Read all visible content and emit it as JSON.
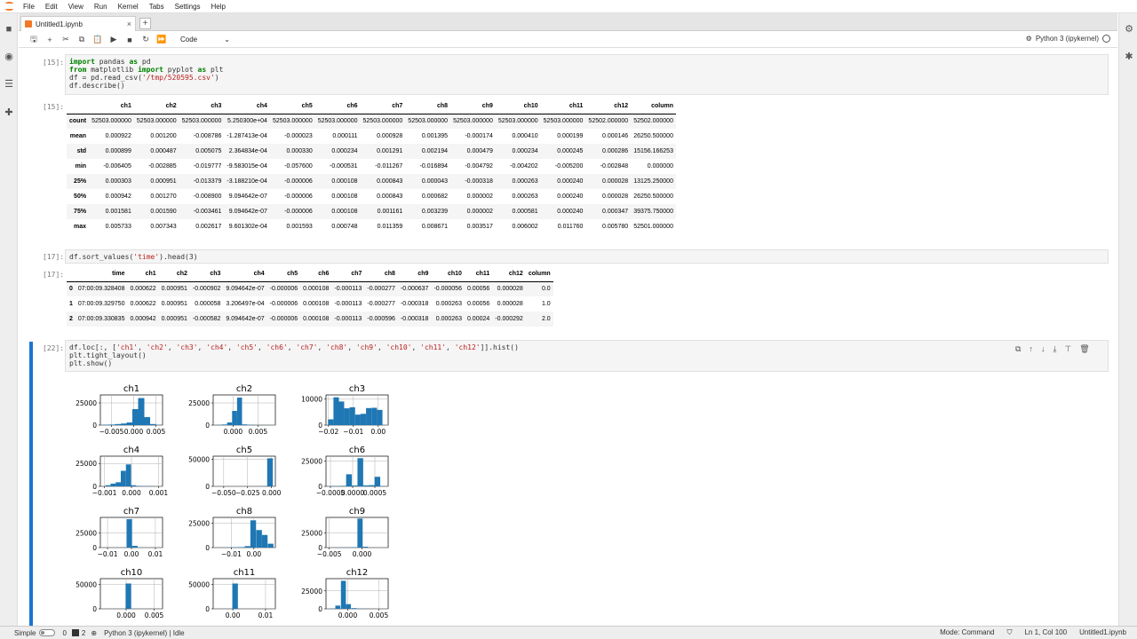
{
  "menubar": {
    "items": [
      "File",
      "Edit",
      "View",
      "Run",
      "Kernel",
      "Tabs",
      "Settings",
      "Help"
    ]
  },
  "tab": {
    "title": "Untitled1.ipynb",
    "close": "×",
    "new": "+"
  },
  "toolbar": {
    "cell_type": "Code",
    "kernel": "Python 3 (ipykernel)"
  },
  "cells": {
    "c1": {
      "prompt": "[15]:",
      "out_prompt": "[15]:",
      "lines": [
        [
          {
            "t": "import",
            "c": "kw"
          },
          {
            "t": " pandas "
          },
          {
            "t": "as",
            "c": "kw"
          },
          {
            "t": " pd"
          }
        ],
        [
          {
            "t": "from",
            "c": "kw"
          },
          {
            "t": " matplotlib "
          },
          {
            "t": "import",
            "c": "kw"
          },
          {
            "t": " pyplot "
          },
          {
            "t": "as",
            "c": "kw"
          },
          {
            "t": " plt"
          }
        ],
        [
          {
            "t": "df = pd.read_csv("
          },
          {
            "t": "'/tmp/520595.csv'",
            "c": "str"
          },
          {
            "t": ")"
          }
        ],
        [
          {
            "t": "df.describe()"
          }
        ]
      ]
    },
    "c2": {
      "prompt": "[17]:",
      "out_prompt": "[17]:",
      "lines": [
        [
          {
            "t": "df.sort_values("
          },
          {
            "t": "'time'",
            "c": "str"
          },
          {
            "t": ").head(3)"
          }
        ]
      ]
    },
    "c3": {
      "prompt": "[22]:",
      "lines": [
        [
          {
            "t": "df.loc[:, ["
          },
          {
            "t": "'ch1'",
            "c": "str"
          },
          {
            "t": ", "
          },
          {
            "t": "'ch2'",
            "c": "str"
          },
          {
            "t": ", "
          },
          {
            "t": "'ch3'",
            "c": "str"
          },
          {
            "t": ", "
          },
          {
            "t": "'ch4'",
            "c": "str"
          },
          {
            "t": ", "
          },
          {
            "t": "'ch5'",
            "c": "str"
          },
          {
            "t": ", "
          },
          {
            "t": "'ch6'",
            "c": "str"
          },
          {
            "t": ", "
          },
          {
            "t": "'ch7'",
            "c": "str"
          },
          {
            "t": ", "
          },
          {
            "t": "'ch8'",
            "c": "str"
          },
          {
            "t": ", "
          },
          {
            "t": "'ch9'",
            "c": "str"
          },
          {
            "t": ", "
          },
          {
            "t": "'ch10'",
            "c": "str"
          },
          {
            "t": ", "
          },
          {
            "t": "'ch11'",
            "c": "str"
          },
          {
            "t": ", "
          },
          {
            "t": "'ch12'",
            "c": "str"
          },
          {
            "t": "]].hist()"
          }
        ],
        [
          {
            "t": "plt.tight_layout()"
          }
        ],
        [
          {
            "t": "plt.show()"
          }
        ]
      ]
    }
  },
  "describe": {
    "columns": [
      "",
      "ch1",
      "ch2",
      "ch3",
      "ch4",
      "ch5",
      "ch6",
      "ch7",
      "ch8",
      "ch9",
      "ch10",
      "ch11",
      "ch12",
      "column"
    ],
    "rows": [
      [
        "count",
        "52503.000000",
        "52503.000000",
        "52503.000000",
        "5.250300e+04",
        "52503.000000",
        "52503.000000",
        "52503.000000",
        "52503.000000",
        "52503.000000",
        "52503.000000",
        "52503.000000",
        "52502.000000",
        "52502.000000"
      ],
      [
        "mean",
        "0.000922",
        "0.001200",
        "-0.008786",
        "-1.287413e-04",
        "-0.000023",
        "0.000111",
        "0.000928",
        "0.001395",
        "-0.000174",
        "0.000410",
        "0.000199",
        "0.000146",
        "26250.500000"
      ],
      [
        "std",
        "0.000899",
        "0.000487",
        "0.005075",
        "2.364834e-04",
        "0.000330",
        "0.000234",
        "0.001291",
        "0.002194",
        "0.000479",
        "0.000234",
        "0.000245",
        "0.000286",
        "15156.166253"
      ],
      [
        "min",
        "-0.006405",
        "-0.002885",
        "-0.019777",
        "-9.583015e-04",
        "-0.057600",
        "-0.000531",
        "-0.011267",
        "-0.016894",
        "-0.004792",
        "-0.004202",
        "-0.005200",
        "-0.002848",
        "0.000000"
      ],
      [
        "25%",
        "0.000303",
        "0.000951",
        "-0.013379",
        "-3.188210e-04",
        "-0.000006",
        "0.000108",
        "0.000843",
        "0.000043",
        "-0.000318",
        "0.000263",
        "0.000240",
        "0.000028",
        "13125.250000"
      ],
      [
        "50%",
        "0.000942",
        "0.001270",
        "-0.008900",
        "9.094642e-07",
        "-0.000006",
        "0.000108",
        "0.000843",
        "0.000682",
        "0.000002",
        "0.000263",
        "0.000240",
        "0.000028",
        "26250.500000"
      ],
      [
        "75%",
        "0.001581",
        "0.001590",
        "-0.003461",
        "9.094642e-07",
        "-0.000006",
        "0.000108",
        "0.001161",
        "0.003239",
        "0.000002",
        "0.000581",
        "0.000240",
        "0.000347",
        "39375.750000"
      ],
      [
        "max",
        "0.005733",
        "0.007343",
        "0.002617",
        "9.601302e-04",
        "0.001593",
        "0.000748",
        "0.011359",
        "0.008671",
        "0.003517",
        "0.006002",
        "0.011760",
        "0.005780",
        "52501.000000"
      ]
    ]
  },
  "head": {
    "columns": [
      "",
      "time",
      "ch1",
      "ch2",
      "ch3",
      "ch4",
      "ch5",
      "ch6",
      "ch7",
      "ch8",
      "ch9",
      "ch10",
      "ch11",
      "ch12",
      "column"
    ],
    "rows": [
      [
        "0",
        "07:00:09.328408",
        "0.000622",
        "0.000951",
        "-0.000902",
        "9.094642e-07",
        "-0.000006",
        "0.000108",
        "-0.000113",
        "-0.000277",
        "-0.000637",
        "-0.000056",
        "0.00056",
        "0.000028",
        "0.0"
      ],
      [
        "1",
        "07:00:09.329750",
        "0.000622",
        "0.000951",
        "0.000058",
        "3.206497e-04",
        "-0.000006",
        "0.000108",
        "-0.000113",
        "-0.000277",
        "-0.000318",
        "0.000263",
        "0.00056",
        "0.000028",
        "1.0"
      ],
      [
        "2",
        "07:00:09.330835",
        "0.000942",
        "0.000951",
        "-0.000582",
        "9.094642e-07",
        "-0.000006",
        "0.000108",
        "-0.000113",
        "-0.000596",
        "-0.000318",
        "0.000263",
        "0.00024",
        "-0.000292",
        "2.0"
      ]
    ]
  },
  "chart_data": [
    {
      "type": "bar",
      "title": "ch1",
      "xticks": [
        "−0.005",
        "0.000",
        "0.005"
      ],
      "yticks": [
        "0",
        "25000"
      ],
      "xlim": [
        -0.0075,
        0.0065
      ],
      "ylim": [
        0,
        34000
      ],
      "bins": [
        [
          -0.0062,
          500
        ],
        [
          -0.0048,
          600
        ],
        [
          -0.0035,
          1200
        ],
        [
          -0.0022,
          1800
        ],
        [
          -0.0009,
          3000
        ],
        [
          0.0004,
          18000
        ],
        [
          0.0017,
          30500
        ],
        [
          0.003,
          9000
        ],
        [
          0.0043,
          1200
        ],
        [
          0.0056,
          300
        ]
      ]
    },
    {
      "type": "bar",
      "title": "ch2",
      "xticks": [
        "0.000",
        "0.005"
      ],
      "yticks": [
        "0",
        "25000"
      ],
      "xlim": [
        -0.004,
        0.0085
      ],
      "ylim": [
        0,
        34000
      ],
      "bins": [
        [
          -0.0027,
          300
        ],
        [
          -0.0017,
          700
        ],
        [
          -0.0007,
          3000
        ],
        [
          0.0003,
          16000
        ],
        [
          0.0013,
          31000
        ],
        [
          0.0023,
          800
        ],
        [
          0.0033,
          400
        ],
        [
          0.0043,
          200
        ],
        [
          0.0053,
          100
        ],
        [
          0.0063,
          100
        ]
      ]
    },
    {
      "type": "bar",
      "title": "ch3",
      "xticks": [
        "−0.02",
        "−0.01",
        "0.00"
      ],
      "yticks": [
        "0",
        "10000"
      ],
      "xlim": [
        -0.021,
        0.004
      ],
      "ylim": [
        0,
        11500
      ],
      "bins": [
        [
          -0.0191,
          2200
        ],
        [
          -0.0169,
          10600
        ],
        [
          -0.0148,
          9000
        ],
        [
          -0.0126,
          6400
        ],
        [
          -0.0104,
          6800
        ],
        [
          -0.0082,
          4000
        ],
        [
          -0.006,
          4300
        ],
        [
          -0.0038,
          6500
        ],
        [
          -0.0016,
          6600
        ],
        [
          0.0006,
          5800
        ]
      ]
    },
    {
      "type": "bar",
      "title": "ch4",
      "xticks": [
        "−0.001",
        "0.000",
        "0.001"
      ],
      "yticks": [
        "0",
        "25000"
      ],
      "xlim": [
        -0.00115,
        0.00115
      ],
      "ylim": [
        0,
        33000
      ],
      "bins": [
        [
          -0.00087,
          1200
        ],
        [
          -0.00068,
          3000
        ],
        [
          -0.00049,
          4500
        ],
        [
          -0.0003,
          17000
        ],
        [
          -0.00011,
          24000
        ],
        [
          8e-05,
          1200
        ],
        [
          0.00027,
          500
        ],
        [
          0.00046,
          300
        ],
        [
          0.00065,
          200
        ],
        [
          0.00084,
          100
        ]
      ]
    },
    {
      "type": "bar",
      "title": "ch5",
      "xticks": [
        "−0.050",
        "−0.025",
        "0.000"
      ],
      "yticks": [
        "0",
        "50000"
      ],
      "xlim": [
        -0.061,
        0.004
      ],
      "ylim": [
        0,
        56000
      ],
      "bins": [
        [
          -0.0547,
          50
        ],
        [
          -0.0488,
          50
        ],
        [
          -0.0429,
          50
        ],
        [
          -0.037,
          50
        ],
        [
          -0.0311,
          50
        ],
        [
          -0.0252,
          50
        ],
        [
          -0.0193,
          50
        ],
        [
          -0.0134,
          50
        ],
        [
          -0.0075,
          100
        ],
        [
          -0.0016,
          52000
        ]
      ]
    },
    {
      "type": "bar",
      "title": "ch6",
      "xticks": [
        "−0.0005",
        "0.0000",
        "0.0005"
      ],
      "yticks": [
        "0",
        "25000"
      ],
      "xlim": [
        -0.0006,
        0.0008
      ],
      "ylim": [
        0,
        30000
      ],
      "bins": [
        [
          -0.000467,
          300
        ],
        [
          -0.000339,
          200
        ],
        [
          -0.000211,
          500
        ],
        [
          -8.3e-05,
          12000
        ],
        [
          4.5e-05,
          800
        ],
        [
          0.000173,
          28000
        ],
        [
          0.000301,
          900
        ],
        [
          0.000429,
          1200
        ],
        [
          0.000557,
          9500
        ],
        [
          0.000685,
          300
        ]
      ]
    },
    {
      "type": "bar",
      "title": "ch7",
      "xticks": [
        "−0.01",
        "0.00",
        "0.01"
      ],
      "yticks": [
        "0",
        "25000"
      ],
      "xlim": [
        -0.013,
        0.013
      ],
      "ylim": [
        0,
        52000
      ],
      "bins": [
        [
          -0.01,
          50
        ],
        [
          -0.0077,
          50
        ],
        [
          -0.0054,
          100
        ],
        [
          -0.0031,
          200
        ],
        [
          -0.0009,
          49000
        ],
        [
          0.0014,
          3000
        ],
        [
          0.0037,
          200
        ],
        [
          0.006,
          50
        ],
        [
          0.0082,
          50
        ],
        [
          0.0105,
          50
        ]
      ]
    },
    {
      "type": "bar",
      "title": "ch8",
      "xticks": [
        "−0.01",
        "0.00"
      ],
      "yticks": [
        "0",
        "25000"
      ],
      "xlim": [
        -0.018,
        0.0095
      ],
      "ylim": [
        0,
        31000
      ],
      "bins": [
        [
          -0.0156,
          100
        ],
        [
          -0.0131,
          100
        ],
        [
          -0.0105,
          200
        ],
        [
          -0.008,
          300
        ],
        [
          -0.0054,
          500
        ],
        [
          -0.0028,
          1500
        ],
        [
          -0.0003,
          28000
        ],
        [
          0.0023,
          18000
        ],
        [
          0.0048,
          13000
        ],
        [
          0.0074,
          4000
        ]
      ]
    },
    {
      "type": "bar",
      "title": "ch9",
      "xticks": [
        "−0.005",
        "0.000"
      ],
      "yticks": [
        "0",
        "25000"
      ],
      "xlim": [
        -0.0055,
        0.004
      ],
      "ylim": [
        0,
        52000
      ],
      "bins": [
        [
          -0.0044,
          100
        ],
        [
          -0.0036,
          100
        ],
        [
          -0.0027,
          200
        ],
        [
          -0.0019,
          300
        ],
        [
          -0.0011,
          600
        ],
        [
          -0.0003,
          50000
        ],
        [
          0.0005,
          1500
        ],
        [
          0.0014,
          100
        ],
        [
          0.0022,
          50
        ],
        [
          0.003,
          50
        ]
      ]
    },
    {
      "type": "bar",
      "title": "ch10",
      "xticks": [
        "0.000",
        "0.005"
      ],
      "yticks": [
        "0",
        "50000"
      ],
      "xlim": [
        -0.0046,
        0.0065
      ],
      "ylim": [
        0,
        62000
      ],
      "bins": [
        [
          -0.0037,
          50
        ],
        [
          -0.0027,
          50
        ],
        [
          -0.0017,
          50
        ],
        [
          -0.0006,
          200
        ],
        [
          0.0004,
          52000
        ],
        [
          0.0014,
          100
        ],
        [
          0.0024,
          50
        ],
        [
          0.0035,
          50
        ],
        [
          0.0045,
          50
        ],
        [
          0.0055,
          50
        ]
      ]
    },
    {
      "type": "bar",
      "title": "ch11",
      "xticks": [
        "0.00",
        "0.01"
      ],
      "yticks": [
        "0",
        "50000"
      ],
      "xlim": [
        -0.006,
        0.013
      ],
      "ylim": [
        0,
        62000
      ],
      "bins": [
        [
          -0.0043,
          50
        ],
        [
          -0.0026,
          100
        ],
        [
          -0.001,
          200
        ],
        [
          0.0007,
          52000
        ],
        [
          0.0024,
          100
        ],
        [
          0.004,
          50
        ],
        [
          0.0057,
          50
        ],
        [
          0.0074,
          50
        ],
        [
          0.0091,
          50
        ],
        [
          0.0108,
          50
        ]
      ]
    },
    {
      "type": "bar",
      "title": "ch12",
      "xticks": [
        "0.000",
        "0.005"
      ],
      "yticks": [
        "0",
        "25000"
      ],
      "xlim": [
        -0.0035,
        0.0065
      ],
      "ylim": [
        0,
        42000
      ],
      "bins": [
        [
          -0.0024,
          300
        ],
        [
          -0.0016,
          4500
        ],
        [
          -0.0007,
          39000
        ],
        [
          0.0001,
          6500
        ],
        [
          0.001,
          1000
        ],
        [
          0.0018,
          400
        ],
        [
          0.0027,
          200
        ],
        [
          0.0035,
          100
        ],
        [
          0.0044,
          50
        ],
        [
          0.0052,
          50
        ]
      ]
    }
  ],
  "cell_icons": [
    "⧉",
    "↑",
    "↓",
    "⤓",
    "⊤",
    "🗑"
  ],
  "statusbar": {
    "mode_toggle": "Simple",
    "count0": "0",
    "count1": "2",
    "kernel_status": "Python 3 (ipykernel) | Idle",
    "mode": "Mode: Command",
    "cursor": "Ln 1, Col 100",
    "file": "Untitled1.ipynb"
  },
  "colors": {
    "accent": "#1976d2",
    "bar": "#1f77b4",
    "jupyter_orange": "#f37726"
  }
}
